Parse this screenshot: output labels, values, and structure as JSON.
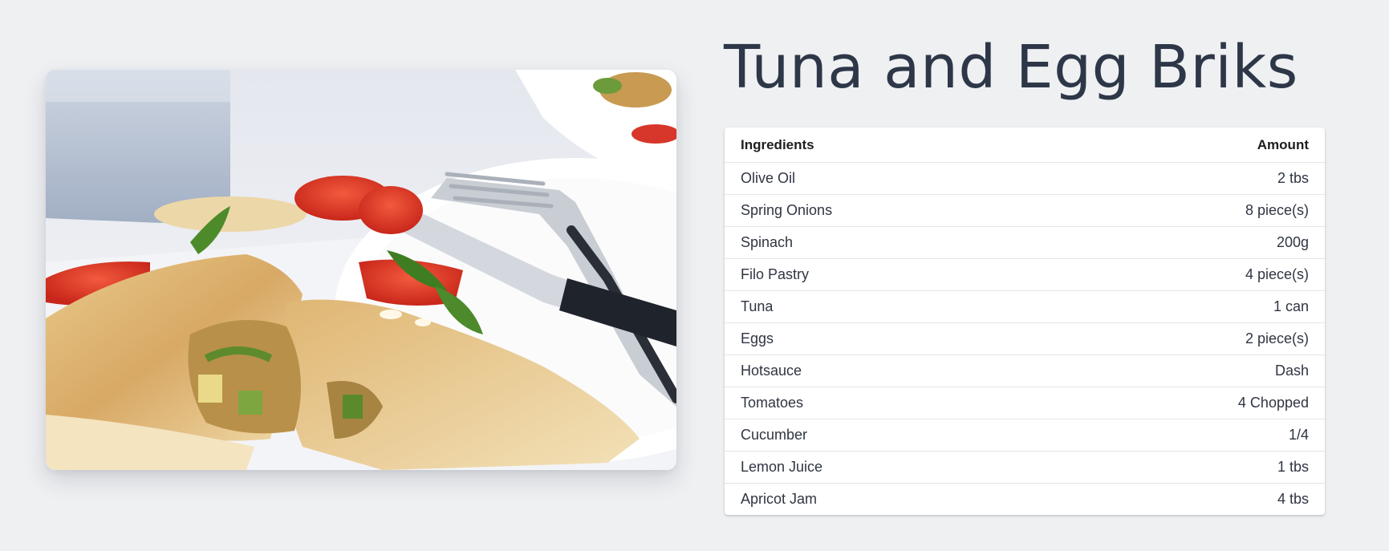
{
  "recipe": {
    "title": "Tuna and Egg Briks",
    "image_alt": "Tuna and Egg Briks on a plate with tomatoes, basil and a fork"
  },
  "table": {
    "headers": {
      "ingredient": "Ingredients",
      "amount": "Amount"
    },
    "rows": [
      {
        "ingredient": "Olive Oil",
        "amount": "2 tbs"
      },
      {
        "ingredient": "Spring Onions",
        "amount": "8 piece(s)"
      },
      {
        "ingredient": "Spinach",
        "amount": "200g"
      },
      {
        "ingredient": "Filo Pastry",
        "amount": "4 piece(s)"
      },
      {
        "ingredient": "Tuna",
        "amount": "1 can"
      },
      {
        "ingredient": "Eggs",
        "amount": "2 piece(s)"
      },
      {
        "ingredient": "Hotsauce",
        "amount": "Dash"
      },
      {
        "ingredient": "Tomatoes",
        "amount": "4 Chopped"
      },
      {
        "ingredient": "Cucumber",
        "amount": "1/4"
      },
      {
        "ingredient": "Lemon Juice",
        "amount": "1 tbs"
      },
      {
        "ingredient": "Apricot Jam",
        "amount": "4 tbs"
      }
    ]
  },
  "colors": {
    "page_background": "#eff0f2",
    "title_text": "#2d3748",
    "table_background": "#ffffff",
    "row_divider": "#e3e5e8"
  }
}
